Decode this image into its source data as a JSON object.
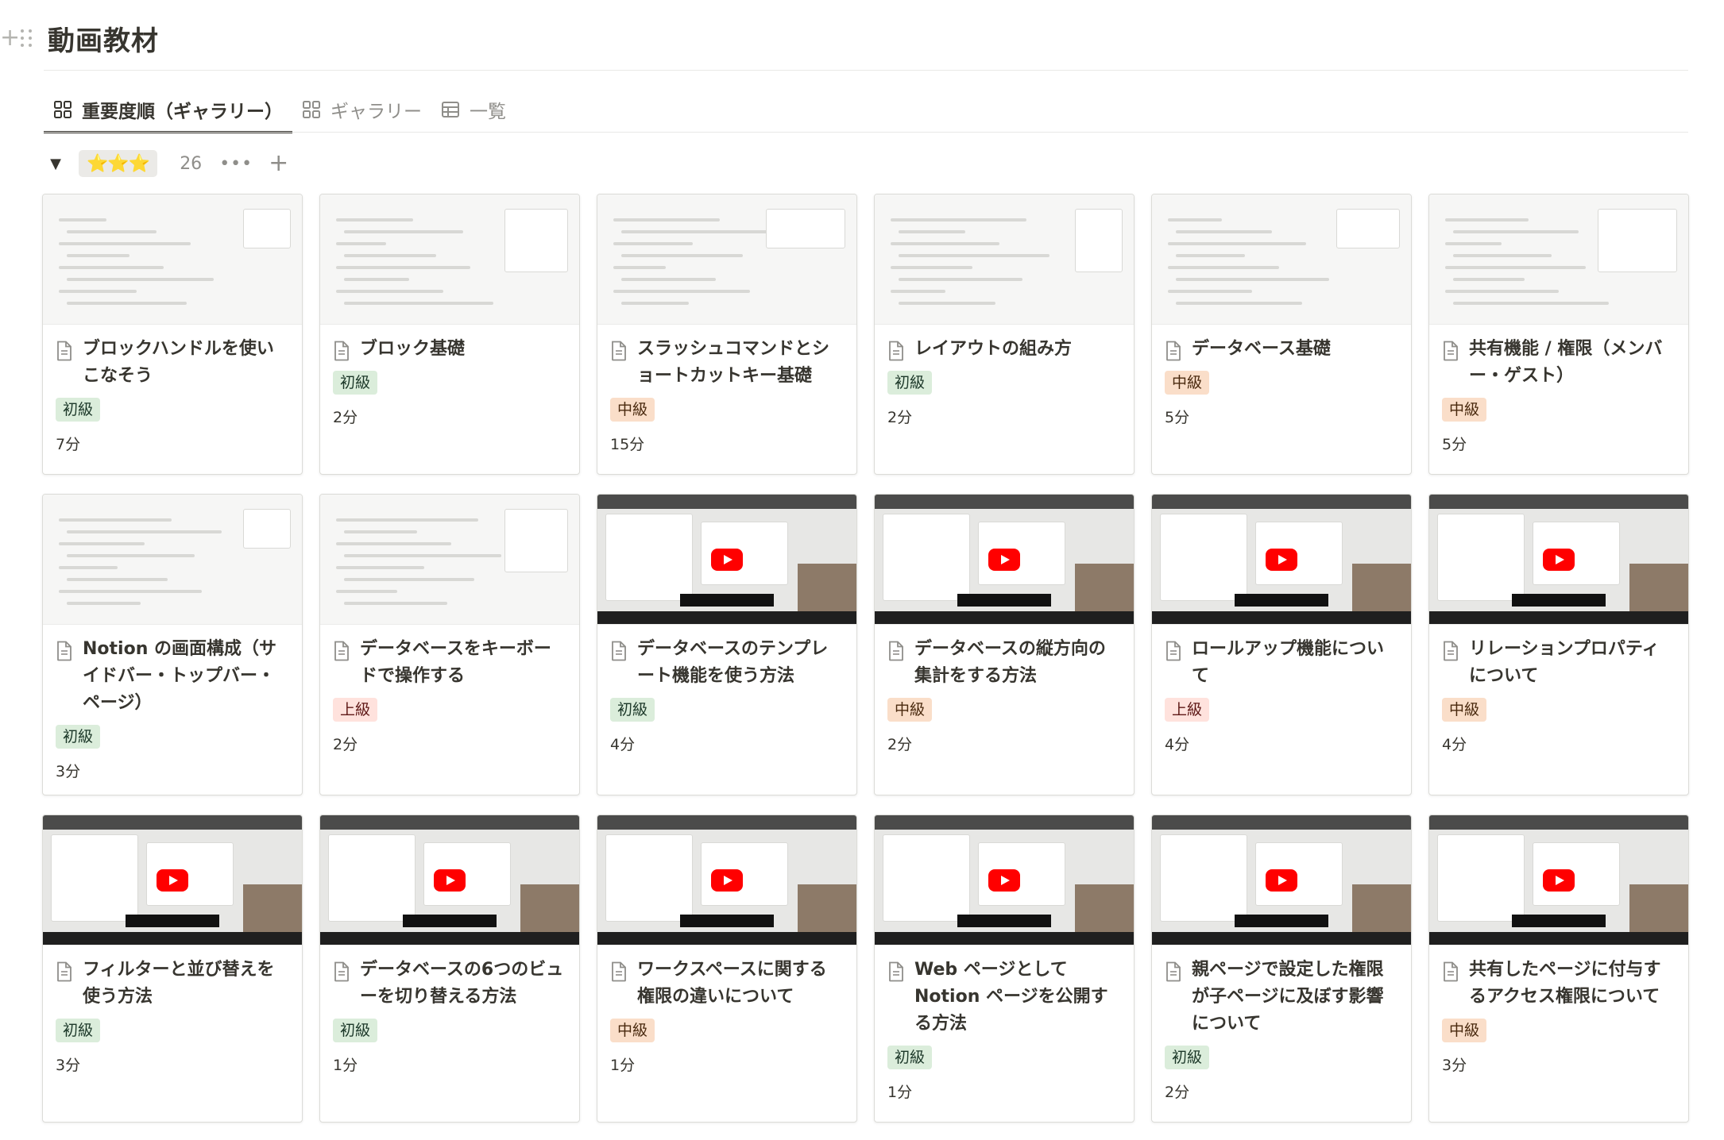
{
  "database": {
    "title": "動画教材"
  },
  "tabs": [
    {
      "label": "重要度順（ギャラリー）",
      "icon": "gallery-icon"
    },
    {
      "label": "ギャラリー",
      "icon": "gallery-icon"
    },
    {
      "label": "一覧",
      "icon": "table-icon"
    }
  ],
  "group": {
    "label": "⭐⭐⭐",
    "count": "26",
    "more": "•••",
    "add": "+"
  },
  "cards": [
    {
      "title": "ブロックハンドルを使いこなそう",
      "level": "初級",
      "duration": "7分"
    },
    {
      "title": "ブロック基礎",
      "level": "初級",
      "duration": "2分"
    },
    {
      "title": "スラッシュコマンドとショートカットキー基礎",
      "level": "中級",
      "duration": "15分"
    },
    {
      "title": "レイアウトの組み方",
      "level": "初級",
      "duration": "2分"
    },
    {
      "title": "データベース基礎",
      "level": "中級",
      "duration": "5分"
    },
    {
      "title": "共有機能 / 権限（メンバー・ゲスト）",
      "level": "中級",
      "duration": "5分"
    },
    {
      "title": "Notion の画面構成（サイドバー・トップバー・ページ）",
      "level": "初級",
      "duration": "3分"
    },
    {
      "title": "データベースをキーボードで操作する",
      "level": "上級",
      "duration": "2分"
    },
    {
      "title": "データベースのテンプレート機能を使う方法",
      "level": "初級",
      "duration": "4分"
    },
    {
      "title": "データベースの縦方向の集計をする方法",
      "level": "中級",
      "duration": "2分"
    },
    {
      "title": "ロールアップ機能について",
      "level": "上級",
      "duration": "4分"
    },
    {
      "title": "リレーションプロパティについて",
      "level": "中級",
      "duration": "4分"
    },
    {
      "title": "フィルターと並び替えを使う方法",
      "level": "初級",
      "duration": "3分"
    },
    {
      "title": "データベースの6つのビューを切り替える方法",
      "level": "初級",
      "duration": "1分"
    },
    {
      "title": "ワークスペースに関する権限の違いについて",
      "level": "中級",
      "duration": "1分"
    },
    {
      "title": "Web ページとして Notion ページを公開する方法",
      "level": "初級",
      "duration": "1分"
    },
    {
      "title": "親ページで設定した権限が子ページに及ぼす影響について",
      "level": "初級",
      "duration": "2分"
    },
    {
      "title": "共有したページに付与するアクセス権限について",
      "level": "中級",
      "duration": "3分"
    }
  ],
  "colors": {
    "easy_bg": "#dbeddb",
    "mid_bg": "#fadec9",
    "hard_bg": "#ffe2dd",
    "star": "#f1b900",
    "youtube": "#ff0000"
  }
}
